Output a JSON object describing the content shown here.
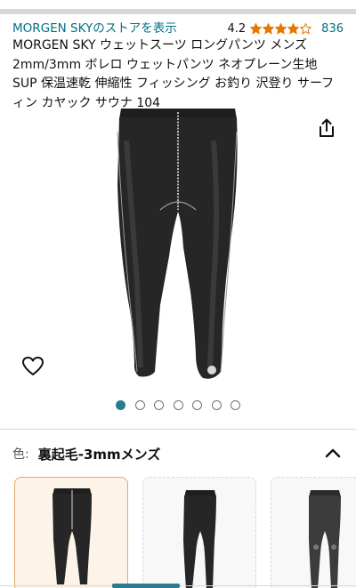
{
  "store": {
    "link_text": "MORGEN SKYのストアを表示",
    "rating_value": "4.2",
    "rating_stars": 4.2,
    "review_count": "836",
    "accent_color": "#007185",
    "star_color": "#e77600"
  },
  "product": {
    "title": "MORGEN SKY ウェットスーツ ロングパンツ メンズ 2mm/3mm ボレロ ウェットパンツ ネオプレーン生地 SUP 保温速乾 伸縮性 フィッシング お釣り 沢登り サーフィン カヤック サウナ 104",
    "image_icon": "long-wetsuit-pants-image"
  },
  "actions": {
    "share_icon": "share-icon",
    "wishlist_icon": "heart-icon"
  },
  "carousel": {
    "total": 7,
    "active_index": 0
  },
  "variant": {
    "label": "色:",
    "value": "裏起毛-3mmメンズ",
    "toggle_icon": "chevron-up-icon"
  },
  "swatches": [
    {
      "name": "裏起毛-3mmメンズ",
      "selected": true
    },
    {
      "name": "option-2",
      "selected": false
    },
    {
      "name": "option-3",
      "selected": false
    }
  ]
}
